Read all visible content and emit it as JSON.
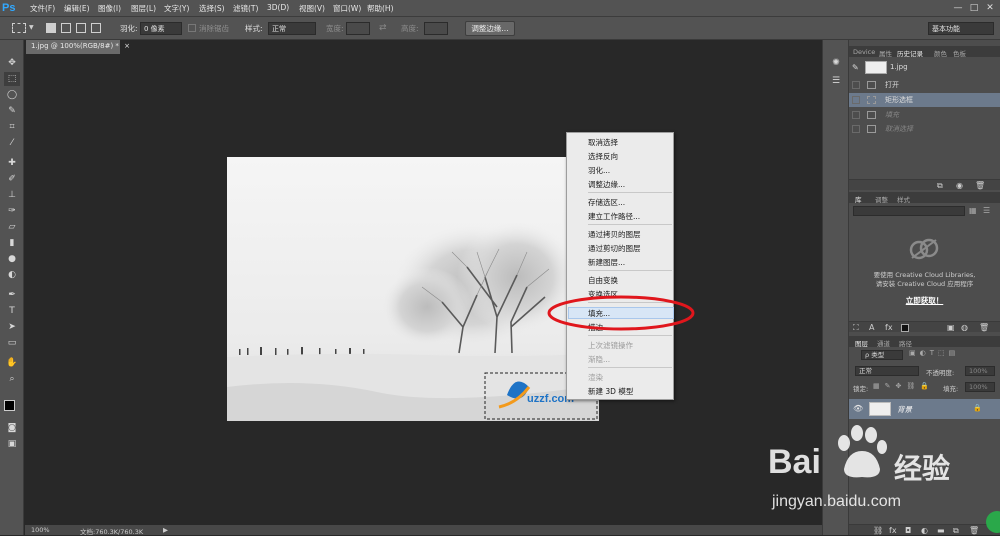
{
  "app": {
    "logo": "Ps"
  },
  "menu": [
    "文件(F)",
    "编辑(E)",
    "图像(I)",
    "图层(L)",
    "文字(Y)",
    "选择(S)",
    "滤镜(T)",
    "3D(D)",
    "视图(V)",
    "窗口(W)",
    "帮助(H)"
  ],
  "window_controls": [
    "—",
    "□",
    "✕"
  ],
  "options": {
    "feather_label": "羽化:",
    "feather_value": "0 像素",
    "antialias_label": "消除锯齿",
    "style_label": "样式:",
    "style_value": "正常",
    "width_label": "宽度:",
    "height_label": "高度:",
    "refine_button": "调整边缘...",
    "workspace": "基本功能"
  },
  "document": {
    "tab_title": "1.jpg @ 100%(RGB/8#) *",
    "close": "×"
  },
  "status": {
    "zoom": "100%",
    "doc_info": "文档:760.3K/760.3K",
    "arrow": "▶"
  },
  "photo_logo": "uzzf.com",
  "context_menu": [
    {
      "label": "取消选择",
      "disabled": false
    },
    {
      "label": "选择反向",
      "disabled": false
    },
    {
      "label": "羽化...",
      "disabled": false
    },
    {
      "label": "调整边缘...",
      "disabled": false
    },
    {
      "label": "存储选区...",
      "disabled": false
    },
    {
      "label": "建立工作路径...",
      "disabled": false
    },
    {
      "label": "通过拷贝的图层",
      "disabled": false
    },
    {
      "label": "通过剪切的图层",
      "disabled": false
    },
    {
      "label": "新建图层...",
      "disabled": false
    },
    {
      "label": "自由变换",
      "disabled": false
    },
    {
      "label": "变换选区",
      "disabled": false
    },
    {
      "label": "填充...",
      "disabled": false
    },
    {
      "label": "描边...",
      "disabled": false
    },
    {
      "label": "上次滤镜操作",
      "disabled": true
    },
    {
      "label": "渐隐...",
      "disabled": true
    },
    {
      "label": "渲染",
      "disabled": true
    },
    {
      "label": "新建 3D 模型",
      "disabled": false
    }
  ],
  "history_panel": {
    "tabs": [
      "Device",
      "属性",
      "历史记录",
      "颜色",
      "色板"
    ],
    "snapshot": "1.jpg",
    "items": [
      {
        "label": "打开",
        "state": "normal"
      },
      {
        "label": "矩形选框",
        "state": "selected"
      },
      {
        "label": "填充",
        "state": "ghost"
      },
      {
        "label": "取消选择",
        "state": "ghost"
      }
    ]
  },
  "library_panel": {
    "tabs": [
      "库",
      "调整",
      "样式"
    ],
    "message_line1": "要使用 Creative Cloud Libraries,",
    "message_line2": "请安装 Creative Cloud 应用程序",
    "link": "立即获取！"
  },
  "layers_panel": {
    "tabs": [
      "图层",
      "通道",
      "路径"
    ],
    "kind_label": "ρ 类型",
    "blend_mode": "正常",
    "opacity_label": "不透明度:",
    "opacity_value": "100%",
    "lock_label": "锁定:",
    "fill_label": "填充:",
    "fill_value": "100%",
    "layer_name": "背景"
  },
  "watermark": {
    "brand": "Bai",
    "brand_cn": "经验",
    "url": "jingyan.baidu.com"
  },
  "colors": {
    "accent": "#31a8ff",
    "annotation_red": "#e0161c",
    "selection": "#6c7a8c"
  }
}
